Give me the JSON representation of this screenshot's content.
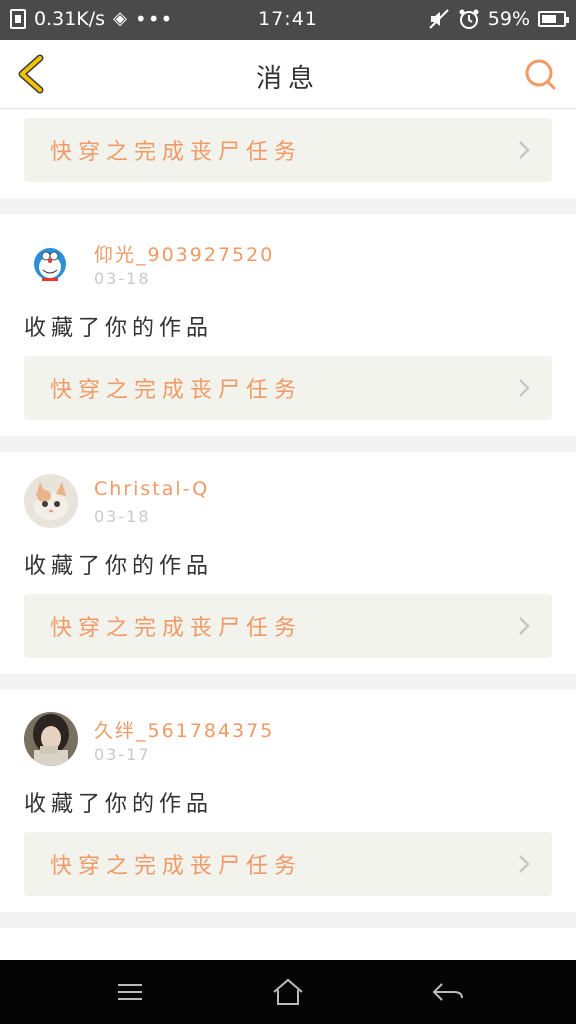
{
  "status_bar": {
    "network_speed": "0.31K/s",
    "dots": "•••",
    "time": "17:41",
    "battery": "59%"
  },
  "header": {
    "title": "消息"
  },
  "colors": {
    "accent": "#f19a66",
    "back_arrow": "#f2c400",
    "card_bg": "#f3f3ed"
  },
  "items": [
    {
      "task": "快穿之完成丧尸任务"
    },
    {
      "username": "仰光_903927520",
      "date": "03-18",
      "action": "收藏了你的作品",
      "task": "快穿之完成丧尸任务",
      "avatar": "doraemon-avatar"
    },
    {
      "username": "Christal-Q",
      "date": "03-18",
      "action": "收藏了你的作品",
      "task": "快穿之完成丧尸任务",
      "avatar": "kitten-avatar"
    },
    {
      "username": "久绊_561784375",
      "date": "03-17",
      "action": "收藏了你的作品",
      "task": "快穿之完成丧尸任务",
      "avatar": "girl-avatar"
    }
  ],
  "icons": {
    "back": "back-arrow-icon",
    "search": "search-icon",
    "chevron": "chevron-right-icon",
    "menu": "menu-icon",
    "home": "home-icon",
    "nav_back": "nav-back-icon"
  }
}
